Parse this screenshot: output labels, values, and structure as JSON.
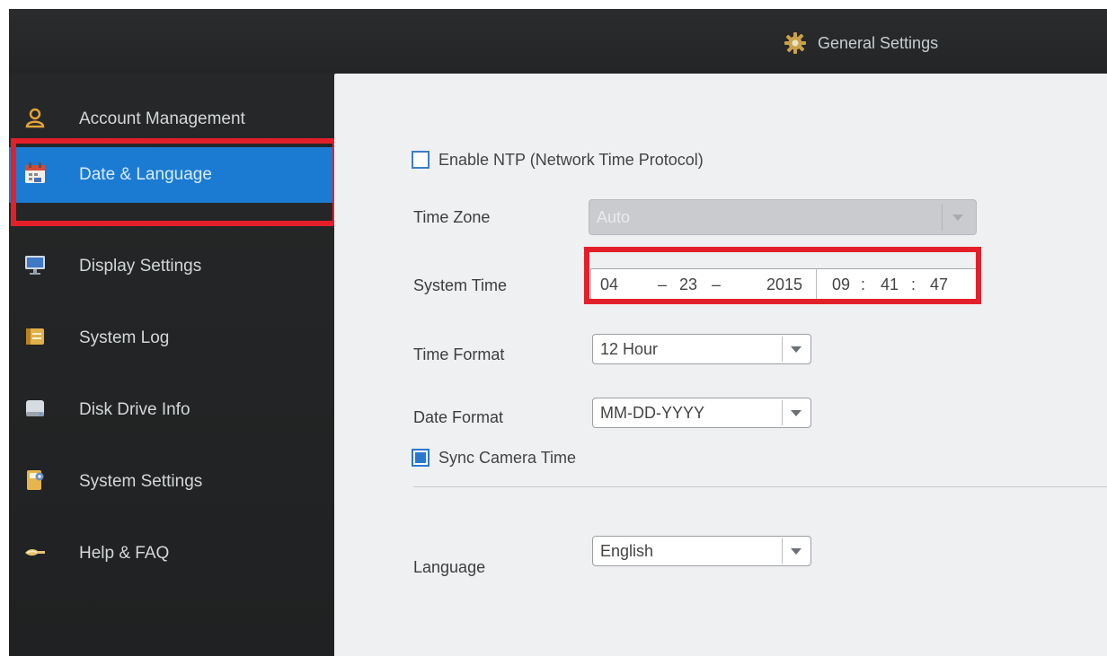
{
  "header": {
    "title": "General Settings",
    "icon": "gear-icon"
  },
  "sidebar": {
    "items": [
      {
        "label": "Account Management",
        "icon": "user-icon"
      },
      {
        "label": "Date & Language",
        "icon": "calendar-icon",
        "active": true
      },
      {
        "label": "Display Settings",
        "icon": "monitor-icon"
      },
      {
        "label": "System Log",
        "icon": "log-icon"
      },
      {
        "label": "Disk Drive Info",
        "icon": "disk-icon"
      },
      {
        "label": "System Settings",
        "icon": "settings-doc-icon"
      },
      {
        "label": "Help & FAQ",
        "icon": "help-icon"
      }
    ]
  },
  "form": {
    "ntp_label": "Enable NTP (Network Time Protocol)",
    "ntp_checked": false,
    "timezone_label": "Time Zone",
    "timezone_value": "Auto",
    "system_time_label": "System Time",
    "system_time": {
      "month": "04",
      "day": "23",
      "year": "2015",
      "hour": "09",
      "minute": "41",
      "second": "47",
      "date_sep": "–",
      "time_sep": ":"
    },
    "time_format_label": "Time Format",
    "time_format_value": "12 Hour",
    "date_format_label": "Date Format",
    "date_format_value": "MM-DD-YYYY",
    "sync_label": "Sync Camera Time",
    "sync_checked": true,
    "language_label": "Language",
    "language_value": "English"
  },
  "colors": {
    "active_nav": "#1b7bd3",
    "highlight": "#e3202a",
    "sidebar_bg": "#262829",
    "content_bg": "#eff0f2"
  }
}
